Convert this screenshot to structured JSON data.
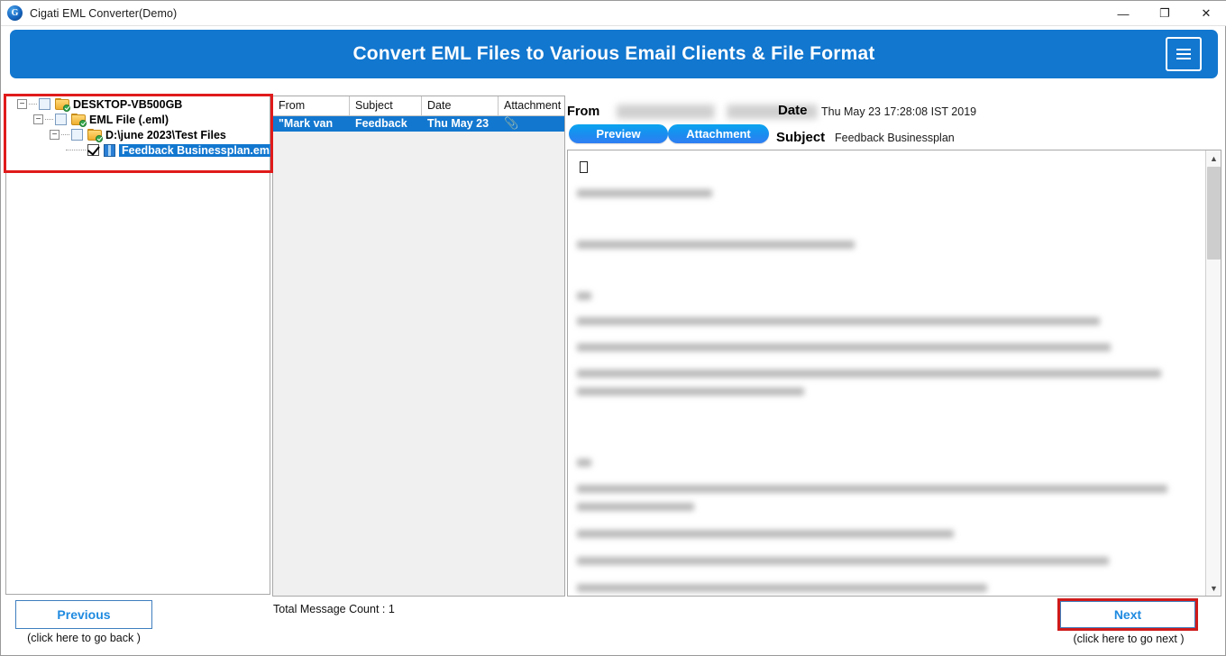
{
  "window": {
    "title": "Cigati EML Converter(Demo)",
    "app_icon": "app-logo-icon",
    "minimize": "—",
    "maximize": "❐",
    "close": "✕"
  },
  "banner": {
    "title": "Convert EML Files to Various Email Clients & File Format",
    "color": "#1277cf",
    "menu_icon": "hamburger-menu-icon"
  },
  "tree": {
    "nodes": [
      {
        "label": "DESKTOP-VB500GB",
        "level": 0,
        "type": "folder",
        "checked": false,
        "expanded": true,
        "selected": false
      },
      {
        "label": "EML File (.eml)",
        "level": 1,
        "type": "folder",
        "checked": false,
        "expanded": true,
        "selected": false
      },
      {
        "label": "D:\\june 2023\\Test Files",
        "level": 2,
        "type": "folder",
        "checked": false,
        "expanded": true,
        "selected": false
      },
      {
        "label": "Feedback Businessplan.eml",
        "level": 3,
        "type": "file",
        "checked": true,
        "expanded": false,
        "selected": true
      }
    ],
    "expander_collapsed": "+",
    "expander_expanded": "−",
    "highlight_color": "#e01b1b"
  },
  "message_list": {
    "columns": [
      "From",
      "Subject",
      "Date",
      "Attachment"
    ],
    "rows": [
      {
        "from": "\"Mark van",
        "subject": "Feedback",
        "date": "Thu May 23",
        "attachment_icon": "paperclip-icon",
        "attachment": "📎",
        "selected": true
      }
    ]
  },
  "preview": {
    "from_label": "From",
    "from_value": "",
    "date_label": "Date",
    "date_value": "Thu May 23 17:28:08 IST 2019",
    "subject_label": "Subject",
    "subject_value": "Feedback Businessplan",
    "tab_preview": "Preview",
    "tab_attachment": "Attachment",
    "body_placeholder_glyph": "missing-glyph-icon",
    "scrollbar": {
      "up_icon": "chevron-up-icon",
      "down_icon": "chevron-down-icon"
    }
  },
  "footer": {
    "previous_label": "Previous",
    "previous_hint": "(click here to  go back )",
    "message_count": "Total Message Count : 1",
    "next_label": "Next",
    "next_hint": "(click here to  go next )",
    "next_highlight_color": "#cf1a1a"
  }
}
